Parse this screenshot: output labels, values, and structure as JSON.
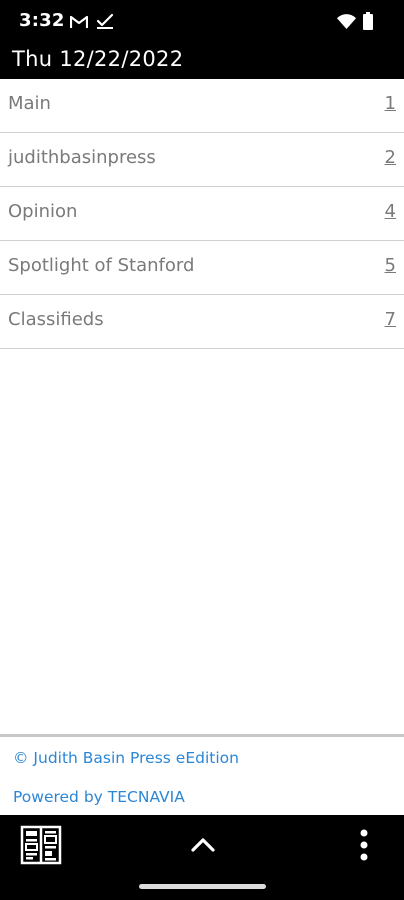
{
  "status_bar": {
    "time": "3:32",
    "icons": [
      "gmail-icon",
      "checkmark-icon",
      "wifi-icon",
      "battery-icon"
    ]
  },
  "header": {
    "date": "Thu 12/22/2022"
  },
  "sections": [
    {
      "title": "Main",
      "page": "1"
    },
    {
      "title": "judithbasinpress",
      "page": "2"
    },
    {
      "title": "Opinion",
      "page": "4"
    },
    {
      "title": "Spotlight of Stanford",
      "page": "5"
    },
    {
      "title": "Classifieds",
      "page": "7"
    }
  ],
  "footer": {
    "copyright": "© Judith Basin Press eEdition",
    "powered_by": "Powered by TECNAVIA"
  },
  "bottom_bar": {
    "icons": [
      "pages-grid-icon",
      "chevron-up-icon",
      "more-vert-icon"
    ]
  },
  "colors": {
    "bar_background": "#000000",
    "text_gray": "#7a7a7a",
    "link_blue": "#2c86d6",
    "divider": "#cfcfcf"
  }
}
